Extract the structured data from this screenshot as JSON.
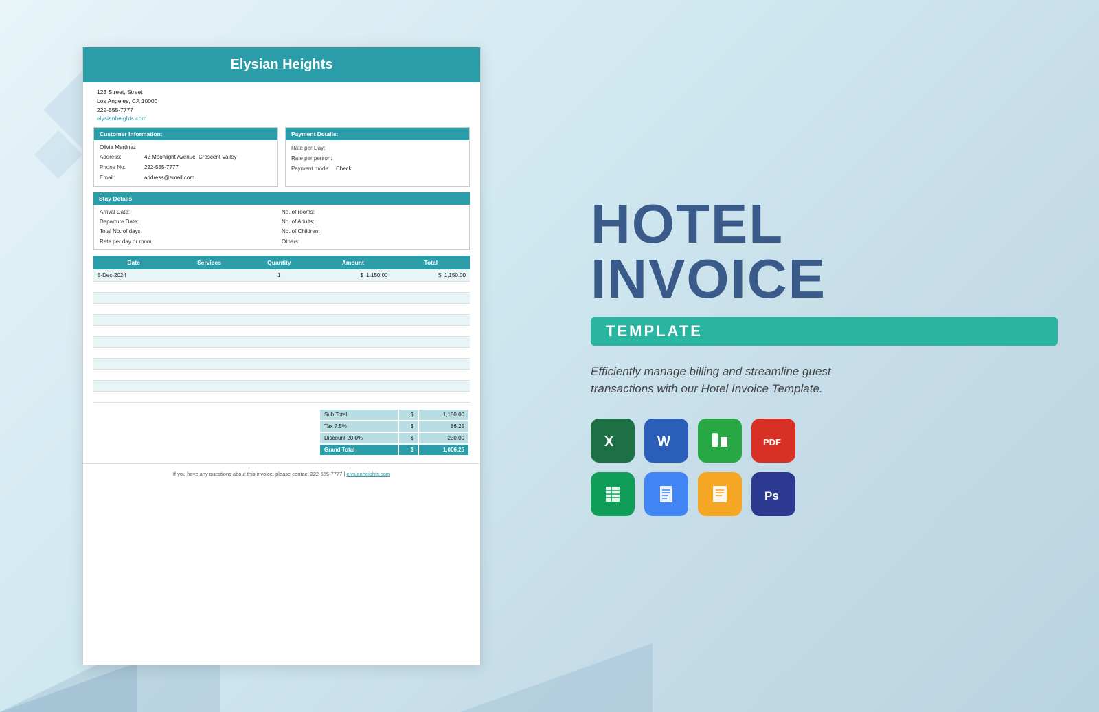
{
  "left": {
    "hotel_name": "Elysian Heights",
    "address_line1": "123 Street, Street",
    "address_line2": "Los Angeles, CA 10000",
    "phone": "222-555-7777",
    "website": "elysianheights.com",
    "customer_section_title": "Customer Information:",
    "customer": {
      "name": "Olivia Martinez",
      "address_label": "Address:",
      "address_value": "42 Moonlight Avenue, Crescent Valley",
      "phone_label": "Phone No:",
      "phone_value": "222-555-7777",
      "email_label": "Email:",
      "email_value": "address@email.com"
    },
    "payment_section_title": "Payment  Details:",
    "payment": {
      "rate_per_day_label": "Rate per Day:",
      "rate_per_day_value": "",
      "rate_per_person_label": "Rate per person:",
      "rate_per_person_value": "",
      "payment_mode_label": "Payment mode:",
      "payment_mode_value": "Check"
    },
    "stay_section_title": "Stay Details",
    "stay": {
      "arrival_label": "Arrival Date:",
      "arrival_value": "",
      "departure_label": "Departure Date:",
      "departure_value": "",
      "total_days_label": "Total No. of days:",
      "total_days_value": "",
      "rate_per_day_label": "Rate per day or room:",
      "rate_per_day_value": "",
      "rooms_label": "No. of rooms:",
      "rooms_value": "",
      "adults_label": "No. of Adults:",
      "adults_value": "",
      "children_label": "No. of Children:",
      "children_value": "",
      "others_label": "Others:",
      "others_value": ""
    },
    "table": {
      "headers": [
        "Date",
        "Services",
        "Quantity",
        "Amount",
        "Total"
      ],
      "rows": [
        {
          "date": "5-Dec-2024",
          "services": "",
          "quantity": "1",
          "amount": "$",
          "amount_val": "1,150.00",
          "total": "$",
          "total_val": "1,150.00"
        },
        {
          "date": "",
          "services": "",
          "quantity": "",
          "amount": "",
          "amount_val": "",
          "total": "",
          "total_val": ""
        },
        {
          "date": "",
          "services": "",
          "quantity": "",
          "amount": "",
          "amount_val": "",
          "total": "",
          "total_val": ""
        },
        {
          "date": "",
          "services": "",
          "quantity": "",
          "amount": "",
          "amount_val": "",
          "total": "",
          "total_val": ""
        },
        {
          "date": "",
          "services": "",
          "quantity": "",
          "amount": "",
          "amount_val": "",
          "total": "",
          "total_val": ""
        },
        {
          "date": "",
          "services": "",
          "quantity": "",
          "amount": "",
          "amount_val": "",
          "total": "",
          "total_val": ""
        },
        {
          "date": "",
          "services": "",
          "quantity": "",
          "amount": "",
          "amount_val": "",
          "total": "",
          "total_val": ""
        },
        {
          "date": "",
          "services": "",
          "quantity": "",
          "amount": "",
          "amount_val": "",
          "total": "",
          "total_val": ""
        },
        {
          "date": "",
          "services": "",
          "quantity": "",
          "amount": "",
          "amount_val": "",
          "total": "",
          "total_val": ""
        },
        {
          "date": "",
          "services": "",
          "quantity": "",
          "amount": "",
          "amount_val": "",
          "total": "",
          "total_val": ""
        },
        {
          "date": "",
          "services": "",
          "quantity": "",
          "amount": "",
          "amount_val": "",
          "total": "",
          "total_val": ""
        },
        {
          "date": "",
          "services": "",
          "quantity": "",
          "amount": "",
          "amount_val": "",
          "total": "",
          "total_val": ""
        }
      ]
    },
    "subtotal_label": "Sub Total",
    "subtotal_value": "1,150.00",
    "tax_label": "Tax 7.5%",
    "tax_value": "86.25",
    "discount_label": "Discount  20.0%",
    "discount_value": "230.00",
    "grand_total_label": "Grand Total",
    "grand_total_value": "1,006.25",
    "dollar": "$",
    "footer_text": "If you have any questions about this invoice, please contact 222-555-7777 | ",
    "footer_link": "elysianheights.com"
  },
  "right": {
    "line1": "HOTEL",
    "line2": "INVOICE",
    "badge": "TEMPLATE",
    "description": "Efficiently manage billing and streamline guest transactions with our Hotel Invoice Template.",
    "icons": [
      {
        "name": "excel-icon",
        "label": "X",
        "type": "excel"
      },
      {
        "name": "word-icon",
        "label": "W",
        "type": "word"
      },
      {
        "name": "numbers-icon",
        "label": "N",
        "type": "numbers"
      },
      {
        "name": "pdf-icon",
        "label": "PDF",
        "type": "pdf"
      },
      {
        "name": "gsheets-icon",
        "label": "G",
        "type": "gsheets"
      },
      {
        "name": "gdocs-icon",
        "label": "D",
        "type": "gdocs"
      },
      {
        "name": "pages-icon",
        "label": "P",
        "type": "pages"
      },
      {
        "name": "ps-icon",
        "label": "Ps",
        "type": "ps"
      }
    ]
  }
}
